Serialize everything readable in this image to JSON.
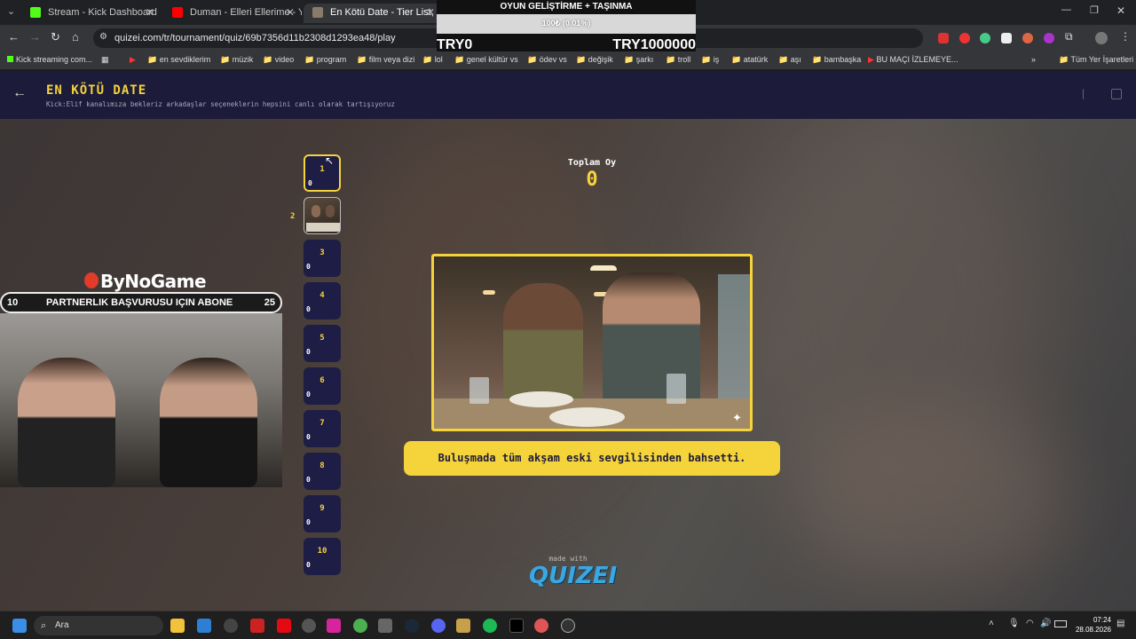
{
  "browser": {
    "tabs": [
      {
        "label": "Stream - Kick Dashboard",
        "active": false
      },
      {
        "label": "Duman - Elleri Ellerime - YouTu",
        "active": false
      },
      {
        "label": "En Kötü Date - Tier List, Kör Sı",
        "active": true
      }
    ],
    "url": "quizei.com/tr/tournament/quiz/69b7356d11b2308d1293ea48/play",
    "bookmarks": [
      "Kick streaming com...",
      "en sevdiklerim",
      "müzik",
      "video",
      "program",
      "film veya dizi",
      "lol",
      "genel kültür vs",
      "ödev vs",
      "değişik",
      "şarkı",
      "troll",
      "iş",
      "atatürk",
      "aşı",
      "bambaşka",
      "BU MAÇI İZLEMEYE...",
      "Tüm Yer İşaretleri"
    ]
  },
  "goal_widget": {
    "title": "OYUN GELİŞTİRME + TAŞINMA",
    "progress_text": "100₺ (0.01%)",
    "progress_fraction": 0.0001,
    "min": "TRY0",
    "max": "TRY1000000"
  },
  "header": {
    "title": "EN KÖTÜ DATE",
    "subtitle": "Kick:Elif kanalımıza bekleriz arkadaşlar seçeneklerin hepsini canlı olarak tartışıyoruz"
  },
  "slots": [
    {
      "num": "1",
      "count": "0"
    },
    {
      "num": "2",
      "count": ""
    },
    {
      "num": "3",
      "count": "0"
    },
    {
      "num": "4",
      "count": "0"
    },
    {
      "num": "5",
      "count": "0"
    },
    {
      "num": "6",
      "count": "0"
    },
    {
      "num": "7",
      "count": "0"
    },
    {
      "num": "8",
      "count": "0"
    },
    {
      "num": "9",
      "count": "0"
    },
    {
      "num": "10",
      "count": "0"
    }
  ],
  "vote": {
    "label": "Toplam Oy",
    "count": "0"
  },
  "caption": "Buluşmada tüm akşam eski sevgilisinden bahsetti.",
  "footer": {
    "made_with": "made with",
    "logo": "QUIZEI"
  },
  "overlay": {
    "brand": "ByNoGame",
    "sub_left": "10",
    "sub_text": "PARTNERLIK BAŞVURUSU IÇIN ABONE",
    "sub_right": "25"
  },
  "taskbar": {
    "search": "Ara",
    "time": "07:24",
    "date": "28.08.2026"
  },
  "colors": {
    "accent": "#f5d33b",
    "header_bg": "#1c1b3a",
    "slot_bg": "#1e1d45",
    "logo": "#3aa7e0"
  }
}
